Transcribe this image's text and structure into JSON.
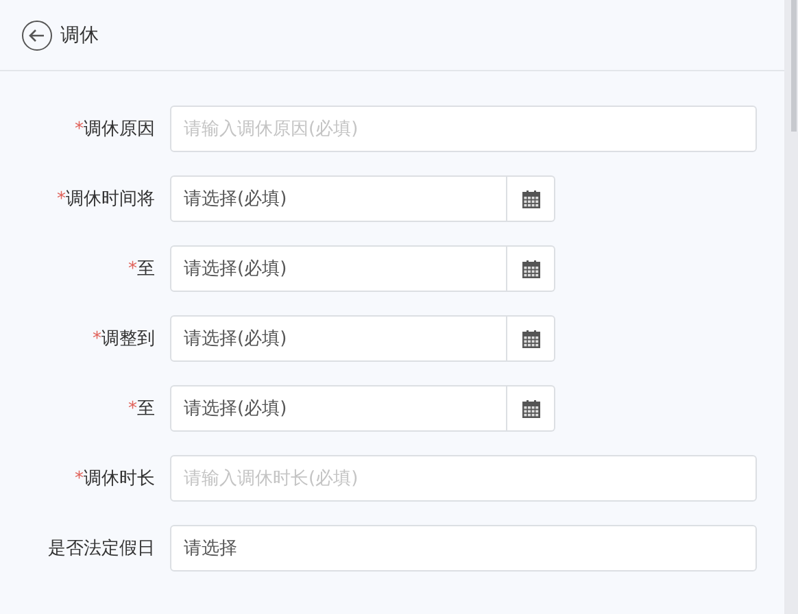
{
  "header": {
    "title": "调休"
  },
  "fields": [
    {
      "label": "调休原因",
      "required": true,
      "kind": "text",
      "placeholder": "请输入调休原因(必填)"
    },
    {
      "label": "调休时间将",
      "required": true,
      "kind": "date",
      "placeholder": "请选择(必填)"
    },
    {
      "label": "至",
      "required": true,
      "kind": "date",
      "placeholder": "请选择(必填)"
    },
    {
      "label": "调整到",
      "required": true,
      "kind": "date",
      "placeholder": "请选择(必填)"
    },
    {
      "label": "至",
      "required": true,
      "kind": "date",
      "placeholder": "请选择(必填)"
    },
    {
      "label": "调休时长",
      "required": true,
      "kind": "text",
      "placeholder": "请输入调休时长(必填)"
    },
    {
      "label": "是否法定假日",
      "required": false,
      "kind": "select",
      "placeholder": "请选择"
    }
  ],
  "required_mark": "*"
}
